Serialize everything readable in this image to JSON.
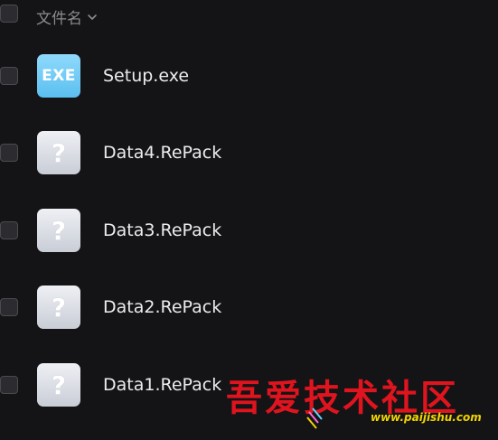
{
  "header": {
    "column_label": "文件名"
  },
  "files": [
    {
      "name": "Setup.exe",
      "icon_label": "EXE",
      "icon": "exe-file-icon"
    },
    {
      "name": "Data4.RePack",
      "icon_label": "?",
      "icon": "unknown-file-icon"
    },
    {
      "name": "Data3.RePack",
      "icon_label": "?",
      "icon": "unknown-file-icon"
    },
    {
      "name": "Data2.RePack",
      "icon_label": "?",
      "icon": "unknown-file-icon"
    },
    {
      "name": "Data1.RePack",
      "icon_label": "?",
      "icon": "unknown-file-icon"
    }
  ],
  "watermark": {
    "title": "吾爱技术社区",
    "url": "www.paijishu.com"
  },
  "colors": {
    "background": "#141416",
    "header_text": "#8b8b90",
    "file_text": "#ececef",
    "exe_icon": "#5bbff0",
    "unknown_icon": "#c9cdd6",
    "watermark_red": "#e0141e",
    "watermark_yellow": "#f0d400"
  }
}
